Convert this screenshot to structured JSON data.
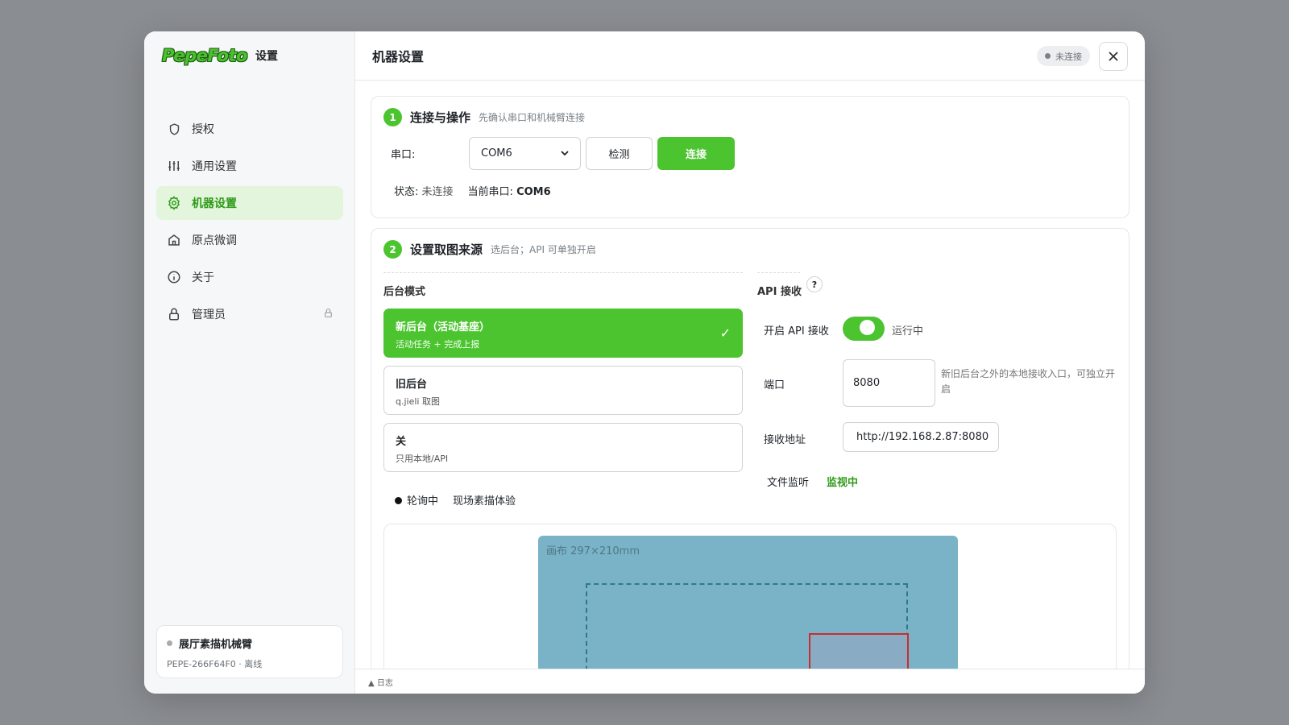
{
  "sidebar": {
    "brand_logo": "PepeFoto",
    "brand_sub": "设置",
    "items": [
      {
        "label": "授权",
        "icon": "shield-icon"
      },
      {
        "label": "通用设置",
        "icon": "sliders-icon"
      },
      {
        "label": "机器设置",
        "icon": "gear-icon",
        "active": true
      },
      {
        "label": "原点微调",
        "icon": "home-icon"
      },
      {
        "label": "关于",
        "icon": "info-icon"
      },
      {
        "label": "管理员",
        "icon": "lock-icon",
        "locked": true
      }
    ],
    "device": {
      "name": "展厅素描机械臂",
      "meta": "PEPE-266F64F0 · 离线"
    }
  },
  "header": {
    "title": "机器设置",
    "status": "未连接"
  },
  "step1": {
    "num": "1",
    "title": "连接与操作",
    "hint": "先确认串口和机械臂连接",
    "serial_label": "串口:",
    "serial_value": "COM6",
    "detect_label": "检测",
    "connect_label": "连接",
    "status_label": "状态:",
    "status_value": "未连接",
    "current_port_label": "当前串口:",
    "current_port_value": "COM6"
  },
  "step2": {
    "num": "2",
    "title": "设置取图来源",
    "hint": "选后台；API 可单独开启",
    "backend_label": "后台模式",
    "options": [
      {
        "title": "新后台（活动基座）",
        "sub": "活动任务 + 完成上报",
        "selected": true
      },
      {
        "title": "旧后台",
        "sub": "q.jieli 取图"
      },
      {
        "title": "关",
        "sub": "只用本地/API"
      }
    ],
    "poll_status": "轮询中",
    "poll_activity": "现场素描体验",
    "api": {
      "label": "API 接收",
      "help": "?",
      "enable_label": "开启 API 接收",
      "enabled": true,
      "enabled_status": "运行中",
      "port_label": "端口",
      "port_value": "8080",
      "port_hint": "新旧后台之外的本地接收入口，可独立开启",
      "address_label": "接收地址",
      "address_value": "http://192.168.2.87:8080",
      "watch_label": "文件监听",
      "watch_value": "监视中"
    },
    "canvas_label": "画布 297×210mm"
  },
  "log_label": "▲ 日志",
  "colors": {
    "accent": "#4cc42f",
    "accent_text": "#2e9a17",
    "canvas": "#7ab3c7",
    "canvas_red": "#c92d2d"
  }
}
